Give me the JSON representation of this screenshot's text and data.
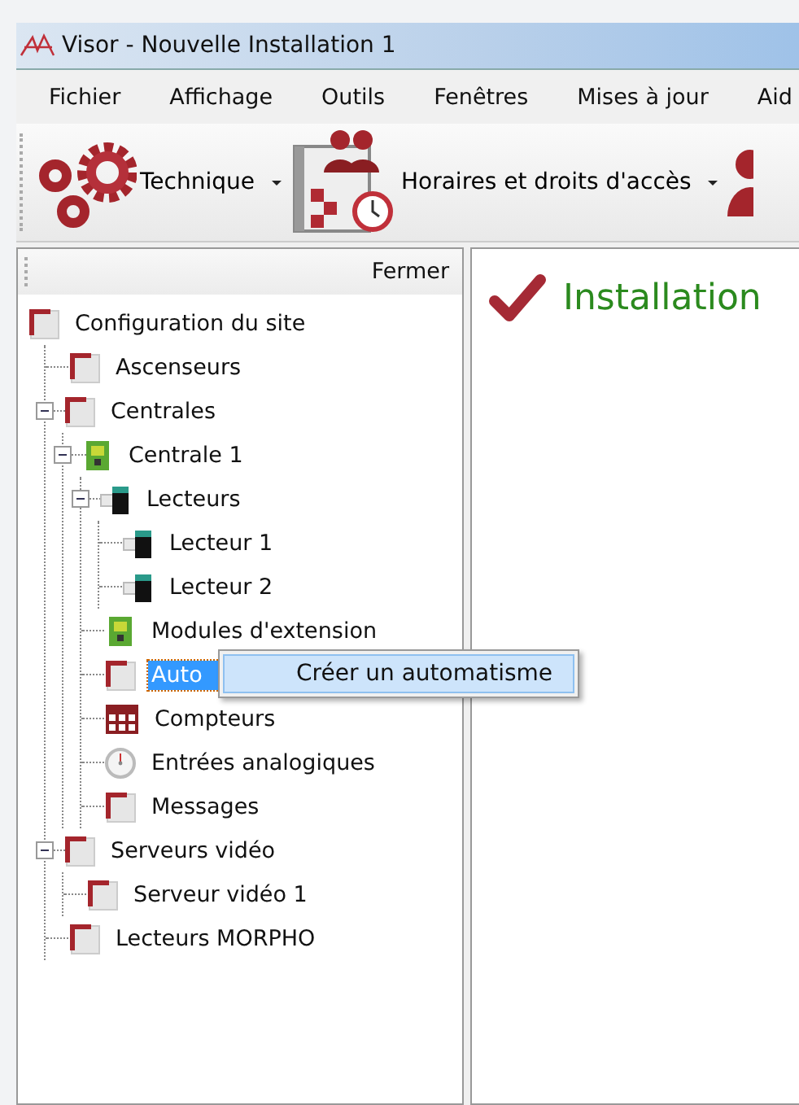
{
  "window": {
    "title": "Visor - Nouvelle Installation 1"
  },
  "menu": [
    "Fichier",
    "Affichage",
    "Outils",
    "Fenêtres",
    "Mises à jour",
    "Aid"
  ],
  "toolbar": [
    {
      "kind": "gears",
      "label": "Technique"
    },
    {
      "kind": "calendar",
      "label": "Horaires et droits d'accès"
    },
    {
      "kind": "person"
    }
  ],
  "panel": {
    "close": "Fermer"
  },
  "tree": [
    {
      "label": "Configuration du site",
      "kind": "folder",
      "selected": false,
      "children": [
        {
          "label": "Ascenseurs",
          "kind": "folder",
          "selected": false
        },
        {
          "label": "Centrales",
          "kind": "folder",
          "selected": false,
          "expanded": true,
          "children": [
            {
              "label": "Centrale 1",
              "kind": "board",
              "selected": false,
              "expanded": true,
              "children": [
                {
                  "label": "Lecteurs",
                  "kind": "reader",
                  "selected": false,
                  "expanded": true,
                  "children": [
                    {
                      "label": "Lecteur 1",
                      "kind": "reader",
                      "selected": false
                    },
                    {
                      "label": "Lecteur 2",
                      "kind": "reader",
                      "selected": false
                    }
                  ]
                },
                {
                  "label": "Modules d'extension",
                  "kind": "board",
                  "selected": false
                },
                {
                  "label": "Auto",
                  "kind": "folder",
                  "selected": true
                },
                {
                  "label": "Compteurs",
                  "kind": "counter",
                  "selected": false
                },
                {
                  "label": "Entrées analogiques",
                  "kind": "gauge",
                  "selected": false
                },
                {
                  "label": "Messages",
                  "kind": "folder",
                  "selected": false
                }
              ]
            }
          ]
        },
        {
          "label": "Serveurs vidéo",
          "kind": "folder",
          "selected": false,
          "expanded": true,
          "children": [
            {
              "label": "Serveur vidéo 1",
              "kind": "folder",
              "selected": false
            }
          ]
        },
        {
          "label": "Lecteurs MORPHO",
          "kind": "folder",
          "selected": false
        }
      ]
    }
  ],
  "context_menu": [
    "Créer un automatisme"
  ],
  "content": {
    "heading": "Installation"
  }
}
